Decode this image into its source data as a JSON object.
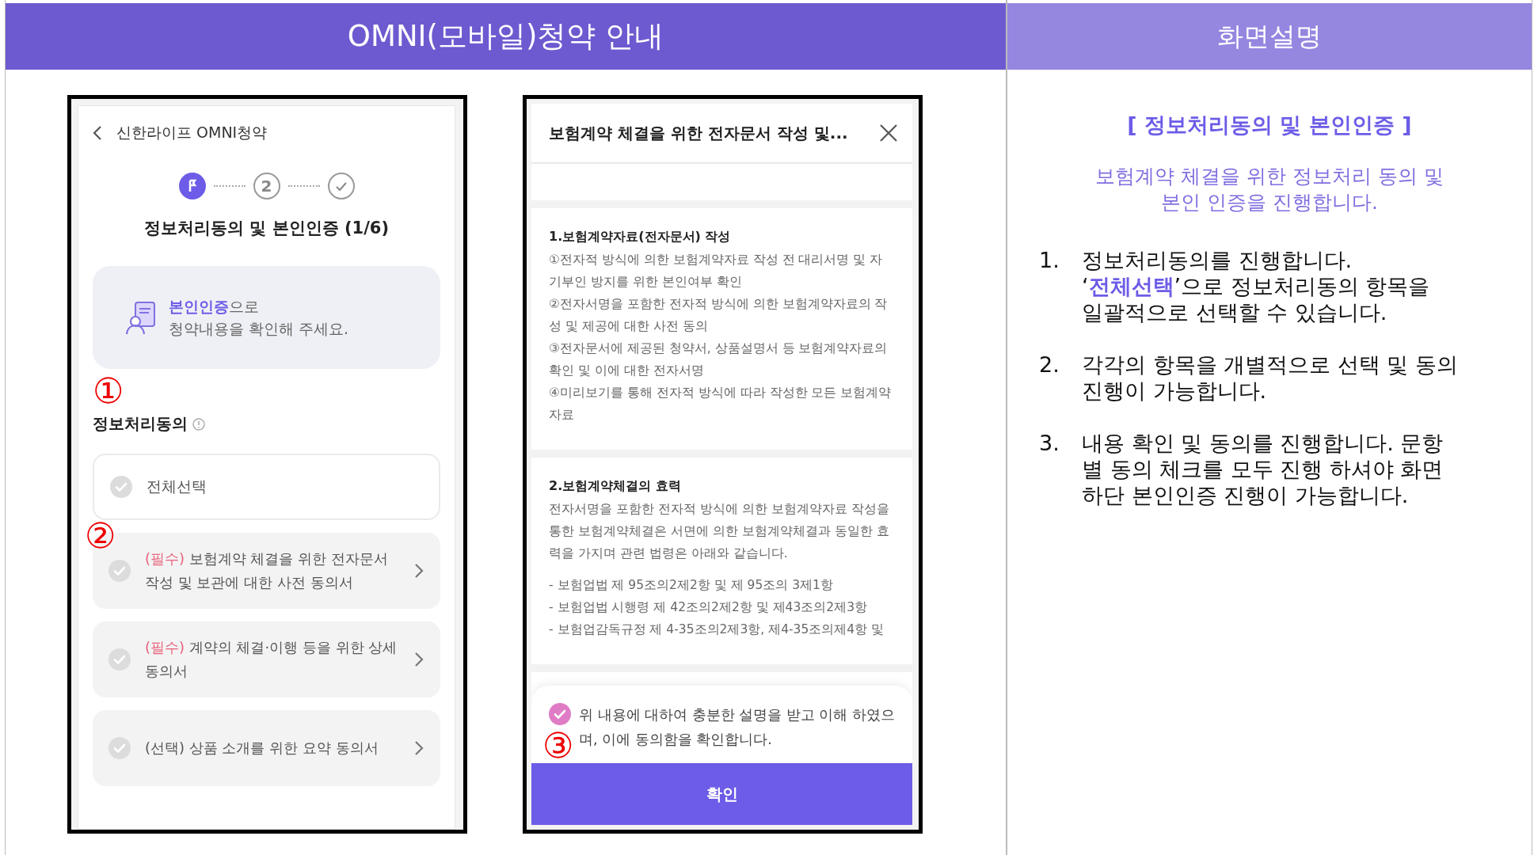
{
  "header": {
    "title": "OMNI(모바일)청약 안내",
    "side_title": "화면설명"
  },
  "app": {
    "back_title": "신한라이프 OMNI청약",
    "steps": [
      {
        "kind": "flag",
        "current": true
      },
      {
        "kind": "number",
        "label": "2",
        "current": false
      },
      {
        "kind": "check",
        "current": false
      }
    ],
    "page_title": "정보처리동의 및 본인인증 (1/6)",
    "notice": "**본인인증**으로\n청약내용을 확인해 주세요.",
    "section_label": "정보처리동의",
    "select_all": {
      "label": "전체선택",
      "checked": false
    },
    "consents": [
      {
        "tag": "(필수)",
        "required": true,
        "text": "보험계약 체결을 위한 전자문서 작성 및 보관에 대한 사전 동의서",
        "checked": false
      },
      {
        "tag": "(필수)",
        "required": true,
        "text": "계약의 체결·이행 등을 위한 상세 동의서",
        "checked": false
      },
      {
        "tag": "(선택)",
        "required": false,
        "text": "상품 소개를 위한 요약 동의서",
        "checked": false
      }
    ]
  },
  "modal": {
    "title": "보험계약 체결을 위한 전자문서 작성 및...",
    "sections": [
      {
        "heading": "1.보험계약자료(전자문서) 작성",
        "paragraphs": [
          "①전자적 방식에 의한 보험계약자료 작성 전 대리서명 및 자기부인 방지를 위한 본인여부 확인",
          "②전자서명을 포함한 전자적 방식에 의한 보험계약자료의 작성 및 제공에 대한 사전 동의",
          "③전자문서에 제공된 청약서, 상품설명서 등 보험계약자료의 확인 및 이에 대한 전자서명",
          "④미리보기를 통해 전자적 방식에 따라 작성한 모든 보험계약자료"
        ]
      },
      {
        "heading": "2.보험계약체결의 효력",
        "paragraphs": [
          "전자서명을 포함한 전자적 방식에 의한 보험계약자료 작성을 통한 보험계약체결은 서면에 의한 보험계약체결과 동일한 효력을 가지며 관련 법령은 아래와 같습니다."
        ],
        "list": [
          "- 보험업법 제 95조의2제2항 및 제 95조의 3제1항",
          "- 보험업법 시행령 제 42조의2제2항 및 제43조의2제3항",
          "- 보험업감독규정 제 4-35조의2제3항, 제4-35조의제4항 및"
        ]
      }
    ],
    "agreement": {
      "text": "위 내용에 대하여 충분한 설명을 받고 이해 하였으며, 이에 동의함을 확인합니다.",
      "checked": true
    },
    "confirm": "확인"
  },
  "annotations": [
    "①",
    "②",
    "③"
  ],
  "guide": {
    "title": "[ 정보처리동의 및 본인인증 ]",
    "subtitle": "보험계약 체결을 위한 정보처리 동의 및\n본인 인증을 진행합니다.",
    "steps": [
      {
        "number": "1.",
        "text": "정보처리동의를 진행합니다. ‘**전체선택**’으로 정보처리동의 항목을 일괄적으로 선택할 수 있습니다."
      },
      {
        "number": "2.",
        "text": "각각의 항목을 개별적으로 선택 및 동의 진행이 가능합니다."
      },
      {
        "number": "3.",
        "text": "내용 확인 및 동의를 진행합니다. 문항 별 동의 체크를 모두 진행 하셔야 화면 하단 본인인증 진행이 가능합니다."
      }
    ]
  }
}
